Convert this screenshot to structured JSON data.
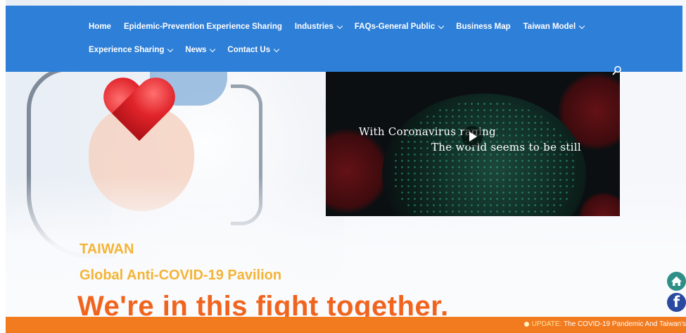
{
  "nav": {
    "row1": [
      {
        "label": "Home",
        "dropdown": false
      },
      {
        "label": "Epidemic-Prevention Experience Sharing",
        "dropdown": false
      },
      {
        "label": "Industries",
        "dropdown": true
      },
      {
        "label": "FAQs-General Public",
        "dropdown": true
      },
      {
        "label": "Business Map",
        "dropdown": false
      },
      {
        "label": "Taiwan Model",
        "dropdown": true
      }
    ],
    "row2": [
      {
        "label": "Experience Sharing",
        "dropdown": true
      },
      {
        "label": "News",
        "dropdown": true
      },
      {
        "label": "Contact Us",
        "dropdown": true
      }
    ],
    "search_icon": "search-icon",
    "color": "#2e7fd8"
  },
  "video": {
    "line1": "With Coronavirus raging",
    "line2": "The world seems to be still",
    "play_icon": "play-icon"
  },
  "hero": {
    "title": "TAIWAN",
    "subtitle": "Global Anti-COVID-19 Pavilion",
    "slogan": "We're in this fight together."
  },
  "ticker": {
    "label": "UPDATE:",
    "text": "The COVID-19 Pandemic And Taiwan's"
  },
  "social": {
    "home_icon": "home-icon",
    "facebook_icon": "facebook-icon"
  },
  "colors": {
    "accent_yellow": "#f4b436",
    "accent_orange": "#f0641e",
    "ticker_bg": "#f27b1f"
  }
}
